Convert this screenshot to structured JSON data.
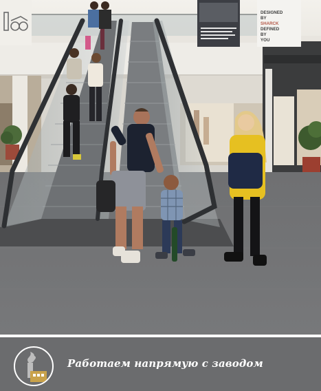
{
  "banner": {
    "caption": "Работаем напрямую с заводом",
    "icon": "factory-icon",
    "background": "#6b6c6e",
    "accent": "#c9a24a"
  },
  "photo": {
    "subject": "mall-escalator-scene",
    "signs": {
      "designed_by": [
        "DESIGNED",
        "BY",
        "SHARCK",
        "DEFINED",
        "BY",
        "YOU"
      ]
    }
  }
}
